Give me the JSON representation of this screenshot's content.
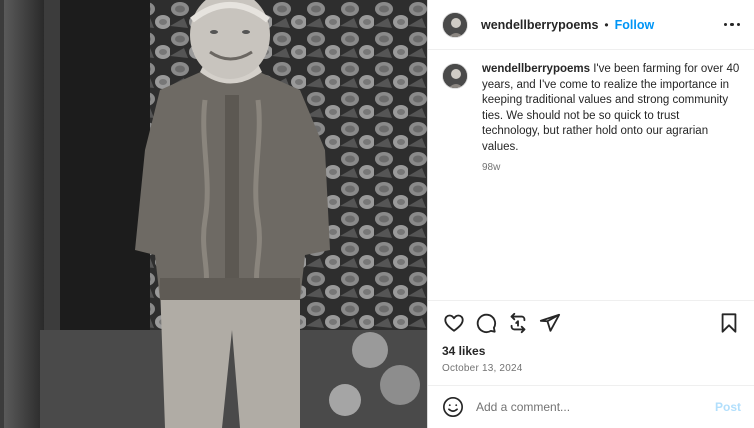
{
  "post": {
    "username": "wendellberrypoems",
    "separator": "•",
    "follow_label": "Follow",
    "caption_username": "wendellberrypoems",
    "caption_text": " I've been farming for over 40 years, and I've come to realize the importance in keeping traditional values and strong community ties. We should not be so quick to trust technology, but rather hold onto our agrarian values.",
    "caption_age": "98w",
    "likes": "34 likes",
    "date": "October 13, 2024"
  },
  "comment_box": {
    "placeholder": "Add a comment...",
    "post_label": "Post"
  },
  "icons": {
    "more": "more-options-icon",
    "like": "heart-icon",
    "comment": "comment-icon",
    "repost": "repost-icon",
    "share": "share-icon",
    "save": "bookmark-icon",
    "emoji": "emoji-icon"
  },
  "colors": {
    "accent": "#0095f6",
    "post_disabled": "#b2dffc",
    "secondary_text": "#737373",
    "divider": "#efefef"
  }
}
